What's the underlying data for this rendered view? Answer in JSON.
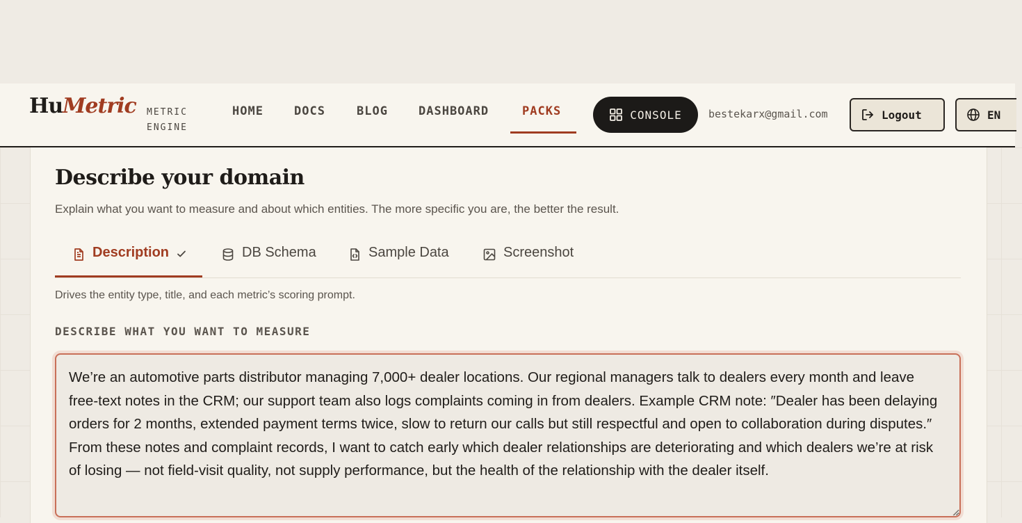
{
  "header": {
    "logo_part1": "Hu",
    "logo_part2": "Metric",
    "tagline": "METRIC ENGINE",
    "nav": [
      {
        "label": "HOME"
      },
      {
        "label": "DOCS"
      },
      {
        "label": "BLOG"
      },
      {
        "label": "DASHBOARD"
      },
      {
        "label": "PACKS",
        "active": true
      }
    ],
    "console_label": "CONSOLE",
    "user_email": "bestekarx@gmail.com",
    "logout_label": "Logout",
    "language_label": "EN"
  },
  "card": {
    "title": "Describe your domain",
    "subtitle": "Explain what you want to measure and about which entities. The more specific you are, the better the result.",
    "tabs": [
      {
        "label": "Description",
        "icon": "document-icon",
        "active": true,
        "completed": true
      },
      {
        "label": "DB Schema",
        "icon": "database-icon"
      },
      {
        "label": "Sample Data",
        "icon": "code-file-icon"
      },
      {
        "label": "Screenshot",
        "icon": "image-icon"
      }
    ],
    "tab_description": "Drives the entity type, title, and each metric’s scoring prompt.",
    "field_label": "DESCRIBE WHAT YOU WANT TO MEASURE",
    "field_value": "We’re an automotive parts distributor managing 7,000+ dealer locations. Our regional managers talk to dealers every month and leave free-text notes in the CRM; our support team also logs complaints coming in from dealers. Example CRM note: ″Dealer has been delaying orders for 2 months, extended payment terms twice, slow to return our calls but still respectful and open to collaboration during disputes.″ From these notes and complaint records, I want to catch early which dealer relationships are deteriorating and which dealers we’re at risk of losing — not field-visit quality, not supply performance, but the health of the relationship with the dealer itself."
  },
  "colors": {
    "accent": "#a03c21",
    "background": "#efebe4",
    "surface": "#f8f5ee",
    "dark": "#1c1a18"
  }
}
